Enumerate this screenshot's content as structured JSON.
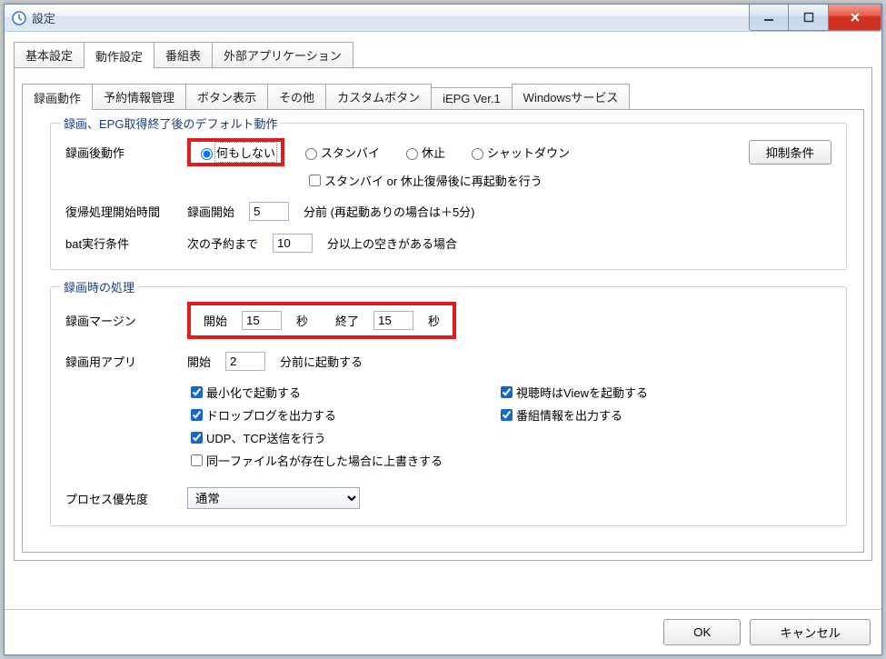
{
  "window": {
    "title": "設定"
  },
  "topTabs": {
    "t0": "基本設定",
    "t1": "動作設定",
    "t2": "番組表",
    "t3": "外部アプリケーション"
  },
  "subTabs": {
    "s0": "録画動作",
    "s1": "予約情報管理",
    "s2": "ボタン表示",
    "s3": "その他",
    "s4": "カスタムボタン",
    "s5": "iEPG Ver.1",
    "s6": "Windowsサービス"
  },
  "group1": {
    "title": "録画、EPG取得終了後のデフォルト動作",
    "postAction": {
      "label": "録画後動作",
      "opt_none": "何もしない",
      "opt_standby": "スタンバイ",
      "opt_hibernate": "休止",
      "opt_shutdown": "シャットダウン",
      "check_reboot": "スタンバイ or 休止復帰後に再起動を行う",
      "btn_suppress": "抑制条件"
    },
    "resume": {
      "label": "復帰処理開始時間",
      "prefix": "録画開始",
      "value": "5",
      "suffix": "分前 (再起動ありの場合は＋5分)"
    },
    "bat": {
      "label": "bat実行条件",
      "prefix": "次の予約まで",
      "value": "10",
      "suffix": "分以上の空きがある場合"
    }
  },
  "group2": {
    "title": "録画時の処理",
    "margin": {
      "label": "録画マージン",
      "start_label": "開始",
      "start_value": "15",
      "start_unit": "秒",
      "end_label": "終了",
      "end_value": "15",
      "end_unit": "秒"
    },
    "recApp": {
      "label": "録画用アプリ",
      "prefix": "開始",
      "value": "2",
      "suffix": "分前に起動する"
    },
    "checks": {
      "c_min": "最小化で起動する",
      "c_view": "視聴時はViewを起動する",
      "c_drop": "ドロップログを出力する",
      "c_pg": "番組情報を出力する",
      "c_udp": "UDP、TCP送信を行う",
      "c_overwrite": "同一ファイル名が存在した場合に上書きする"
    },
    "priority": {
      "label": "プロセス優先度",
      "value": "通常"
    }
  },
  "buttons": {
    "ok": "OK",
    "cancel": "キャンセル"
  }
}
